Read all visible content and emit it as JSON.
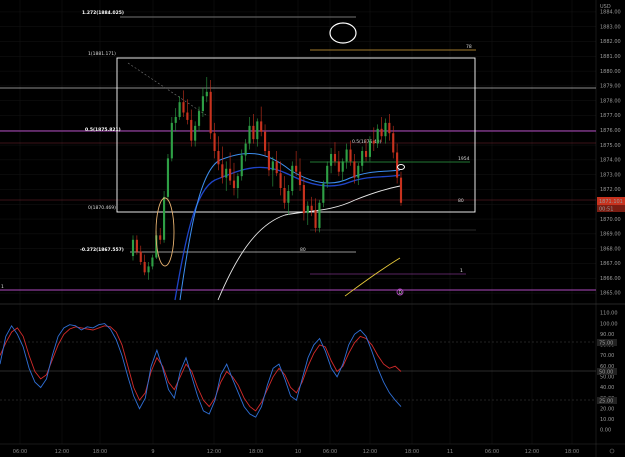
{
  "currency_label": "USD",
  "price_axis": {
    "levels": [
      "1884.00",
      "1883.00",
      "1882.00",
      "1881.00",
      "1880.00",
      "1879.00",
      "1878.00",
      "1877.00",
      "1876.00",
      "1875.00",
      "1874.00",
      "1873.00",
      "1872.00",
      "1871.00",
      "1870.00",
      "1869.00",
      "1868.00",
      "1867.00",
      "1866.00",
      "1865.00"
    ],
    "current_price": "1871.101",
    "countdown": "00:51"
  },
  "oscillator_axis": {
    "levels": [
      "110.00",
      "100.00",
      "90.00",
      "80.00",
      "70.00",
      "60.00",
      "50.00",
      "40.00",
      "30.00",
      "20.00",
      "10.00",
      "0.00"
    ],
    "badge_upper": "75.00",
    "badge_mid": "50.00",
    "badge_lower": "25.00"
  },
  "time_axis": [
    "06:00",
    "12:00",
    "18:00",
    "9",
    "12:00",
    "18:00",
    "10",
    "06:00",
    "12:00",
    "18:00",
    "11",
    "06:00",
    "12:00",
    "18:00"
  ],
  "fib_labels": {
    "ext_1272": "1.272(1884.025)",
    "level_1": "1(1881.171)",
    "level_05": "0.5(1875.821)",
    "level_0": "0(1870.469)",
    "level_neg0272": "-0.272(1867.557)"
  },
  "levels_right": {
    "l78": "78",
    "l786_red": "0.5(1875.40)",
    "l1954": "1954",
    "l80_right": "80",
    "l80_left": "80",
    "l1": "1"
  },
  "marker_letter": "D",
  "colors": {
    "background": "#000000",
    "candle_up": "#2e9f45",
    "candle_down": "#c8321e",
    "fib_line": "#bfbfbf",
    "magenta_line": "#b04ac0",
    "orange_line": "#d8a33a",
    "box": "#ffffff",
    "rsi_red": "#d22a2a",
    "rsi_blue": "#2f6fd6"
  },
  "chart_data": {
    "type": "candlestick",
    "price_range": [
      1864.8,
      1884.4
    ],
    "oscillator_range": [
      0,
      110
    ],
    "candles": [
      [
        1867.5,
        1868.9,
        1867.2,
        1868.6
      ],
      [
        1868.6,
        1868.9,
        1867.6,
        1867.8
      ],
      [
        1867.8,
        1868.2,
        1866.9,
        1867.1
      ],
      [
        1867.1,
        1867.6,
        1866.2,
        1866.4
      ],
      [
        1866.4,
        1867.1,
        1865.9,
        1866.8
      ],
      [
        1866.8,
        1867.6,
        1866.6,
        1867.4
      ],
      [
        1867.4,
        1869.2,
        1867.3,
        1868.9
      ],
      [
        1868.9,
        1869.4,
        1868.3,
        1868.6
      ],
      [
        1868.6,
        1871.9,
        1868.4,
        1871.5
      ],
      [
        1871.5,
        1874.4,
        1871.2,
        1874.1
      ],
      [
        1874.1,
        1876.9,
        1873.9,
        1876.5
      ],
      [
        1876.5,
        1877.5,
        1875.9,
        1876.9
      ],
      [
        1876.9,
        1878.3,
        1876.7,
        1877.9
      ],
      [
        1877.9,
        1878.7,
        1876.9,
        1877.2
      ],
      [
        1877.2,
        1878.1,
        1876.4,
        1876.7
      ],
      [
        1876.7,
        1877.4,
        1874.9,
        1875.3
      ],
      [
        1875.3,
        1876.6,
        1874.9,
        1876.3
      ],
      [
        1876.3,
        1877.6,
        1875.9,
        1877.3
      ],
      [
        1877.3,
        1878.9,
        1876.9,
        1878.3
      ],
      [
        1878.3,
        1879.6,
        1877.9,
        1878.6
      ],
      [
        1878.6,
        1879.4,
        1875.4,
        1875.8
      ],
      [
        1875.8,
        1876.5,
        1874.1,
        1874.6
      ],
      [
        1874.6,
        1875.6,
        1873.3,
        1873.7
      ],
      [
        1873.7,
        1874.9,
        1872.4,
        1872.8
      ],
      [
        1872.8,
        1873.9,
        1871.9,
        1873.4
      ],
      [
        1873.4,
        1874.5,
        1872.3,
        1872.6
      ],
      [
        1872.6,
        1873.8,
        1871.6,
        1872.1
      ],
      [
        1872.1,
        1873.1,
        1871.4,
        1872.9
      ],
      [
        1872.9,
        1874.7,
        1872.6,
        1874.3
      ],
      [
        1874.3,
        1875.4,
        1873.9,
        1875.1
      ],
      [
        1875.1,
        1876.9,
        1874.7,
        1876.3
      ],
      [
        1876.3,
        1877.1,
        1875.1,
        1875.4
      ],
      [
        1875.4,
        1876.8,
        1874.9,
        1876.6
      ],
      [
        1876.6,
        1877.6,
        1875.6,
        1875.9
      ],
      [
        1875.9,
        1876.4,
        1874.3,
        1874.6
      ],
      [
        1874.6,
        1875.2,
        1872.9,
        1873.3
      ],
      [
        1873.3,
        1874.2,
        1872.2,
        1873.9
      ],
      [
        1873.9,
        1874.6,
        1872.9,
        1873.1
      ],
      [
        1873.1,
        1873.9,
        1871.6,
        1872.1
      ],
      [
        1872.1,
        1872.9,
        1870.7,
        1871.1
      ],
      [
        1871.1,
        1872.3,
        1870.3,
        1871.9
      ],
      [
        1871.9,
        1873.9,
        1871.6,
        1873.6
      ],
      [
        1873.6,
        1874.6,
        1872.9,
        1873.2
      ],
      [
        1873.2,
        1874.1,
        1871.9,
        1872.3
      ],
      [
        1872.3,
        1872.8,
        1869.9,
        1870.4
      ],
      [
        1870.4,
        1871.2,
        1869.6,
        1870.9
      ],
      [
        1870.9,
        1871.5,
        1870.2,
        1870.6
      ],
      [
        1870.6,
        1871.4,
        1869.1,
        1869.4
      ],
      [
        1869.4,
        1871.3,
        1869.1,
        1871.1
      ],
      [
        1871.1,
        1872.6,
        1870.8,
        1872.4
      ],
      [
        1872.4,
        1873.9,
        1872.1,
        1873.6
      ],
      [
        1873.6,
        1874.8,
        1873.1,
        1874.4
      ],
      [
        1874.4,
        1875.2,
        1873.6,
        1873.9
      ],
      [
        1873.9,
        1874.6,
        1872.9,
        1873.2
      ],
      [
        1873.2,
        1874.1,
        1872.6,
        1873.9
      ],
      [
        1873.9,
        1875.1,
        1873.4,
        1874.7
      ],
      [
        1874.7,
        1875.3,
        1873.6,
        1873.9
      ],
      [
        1873.9,
        1874.4,
        1872.4,
        1872.8
      ],
      [
        1872.8,
        1873.8,
        1872.3,
        1873.6
      ],
      [
        1873.6,
        1874.9,
        1873.2,
        1874.6
      ],
      [
        1874.6,
        1875.4,
        1873.9,
        1874.2
      ],
      [
        1874.2,
        1875.6,
        1873.9,
        1875.3
      ],
      [
        1875.3,
        1876.2,
        1874.6,
        1875.1
      ],
      [
        1875.1,
        1876.4,
        1874.8,
        1876.1
      ],
      [
        1876.1,
        1876.9,
        1875.2,
        1875.6
      ],
      [
        1875.6,
        1876.8,
        1875.1,
        1876.5
      ],
      [
        1876.5,
        1877.1,
        1875.3,
        1875.8
      ],
      [
        1875.8,
        1876.3,
        1874.1,
        1874.5
      ],
      [
        1874.5,
        1875.1,
        1872.4,
        1872.8
      ],
      [
        1872.8,
        1873.2,
        1870.9,
        1871.1
      ]
    ],
    "oscillator": {
      "red": [
        70,
        82,
        92,
        96,
        88,
        70,
        55,
        48,
        52,
        66,
        80,
        90,
        95,
        97,
        96,
        95,
        94,
        96,
        98,
        97,
        92,
        80,
        60,
        40,
        28,
        35,
        55,
        68,
        60,
        45,
        38,
        50,
        62,
        55,
        40,
        28,
        22,
        30,
        45,
        55,
        50,
        42,
        30,
        22,
        18,
        26,
        38,
        50,
        58,
        52,
        40,
        35,
        45,
        60,
        72,
        80,
        78,
        65,
        55,
        60,
        72,
        82,
        88,
        86,
        80,
        70,
        62,
        58,
        60,
        55
      ],
      "blue": [
        62,
        88,
        98,
        90,
        78,
        58,
        45,
        40,
        48,
        70,
        88,
        96,
        99,
        98,
        94,
        97,
        96,
        99,
        100,
        95,
        85,
        70,
        50,
        32,
        20,
        30,
        60,
        75,
        58,
        38,
        30,
        55,
        68,
        50,
        32,
        18,
        15,
        28,
        52,
        62,
        48,
        35,
        22,
        15,
        12,
        22,
        42,
        58,
        62,
        48,
        32,
        28,
        48,
        68,
        80,
        86,
        74,
        58,
        50,
        62,
        80,
        90,
        94,
        88,
        74,
        58,
        45,
        35,
        28,
        22
      ]
    },
    "series": [
      {
        "name": "",
        "note": "blue moving averages"
      },
      {
        "name": "",
        "note": "white moving average"
      }
    ]
  }
}
